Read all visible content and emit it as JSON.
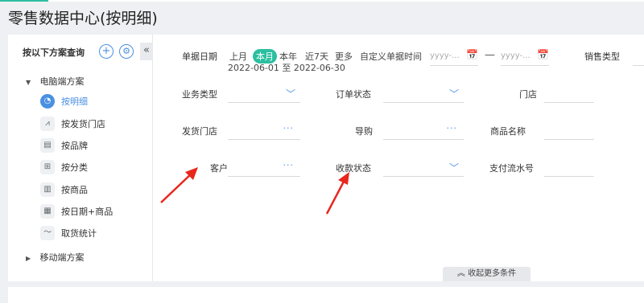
{
  "page": {
    "title": "零售数据中心(按明细)"
  },
  "sidebar": {
    "header": "按以下方案查询",
    "add_icon": "plus-icon",
    "settings_icon": "gear-icon",
    "collapse_glyph": "«",
    "groups": [
      {
        "label": "电脑端方案",
        "expanded": true
      },
      {
        "label": "移动端方案",
        "expanded": false
      }
    ],
    "items": [
      {
        "label": "按明细",
        "icon": "clock-icon",
        "active": true
      },
      {
        "label": "按发货门店",
        "icon": "chart-icon"
      },
      {
        "label": "按品牌",
        "icon": "id-card-icon"
      },
      {
        "label": "按分类",
        "icon": "grid-icon"
      },
      {
        "label": "按商品",
        "icon": "bar-chart-icon"
      },
      {
        "label": "按日期+商品",
        "icon": "calendar-grid-icon"
      },
      {
        "label": "取货统计",
        "icon": "trend-icon"
      }
    ]
  },
  "filters": {
    "date": {
      "label": "单据日期",
      "options": [
        "上月",
        "本月",
        "本年",
        "近7天",
        "更多"
      ],
      "selected": "本月",
      "custom_label": "自定义单据时间",
      "start_placeholder": "yyyy-...",
      "end_placeholder": "yyyy-...",
      "separator": "—",
      "range_text": "2022-06-01 至 2022-06-30"
    },
    "sales_type": {
      "label": "销售类型"
    },
    "business_type": {
      "label": "业务类型"
    },
    "order_status": {
      "label": "订单状态"
    },
    "store": {
      "label": "门店"
    },
    "shipping_store": {
      "label": "发货门店"
    },
    "guide": {
      "label": "导购"
    },
    "product_name": {
      "label": "商品名称"
    },
    "customer": {
      "label": "客户"
    },
    "payment_status": {
      "label": "收款状态"
    },
    "payment_serial": {
      "label": "支付流水号"
    }
  },
  "collapse_more": {
    "label": "收起更多条件"
  },
  "colors": {
    "accent": "#4a90e2",
    "teal": "#2bbfa0",
    "arrow": "#e8271c"
  }
}
